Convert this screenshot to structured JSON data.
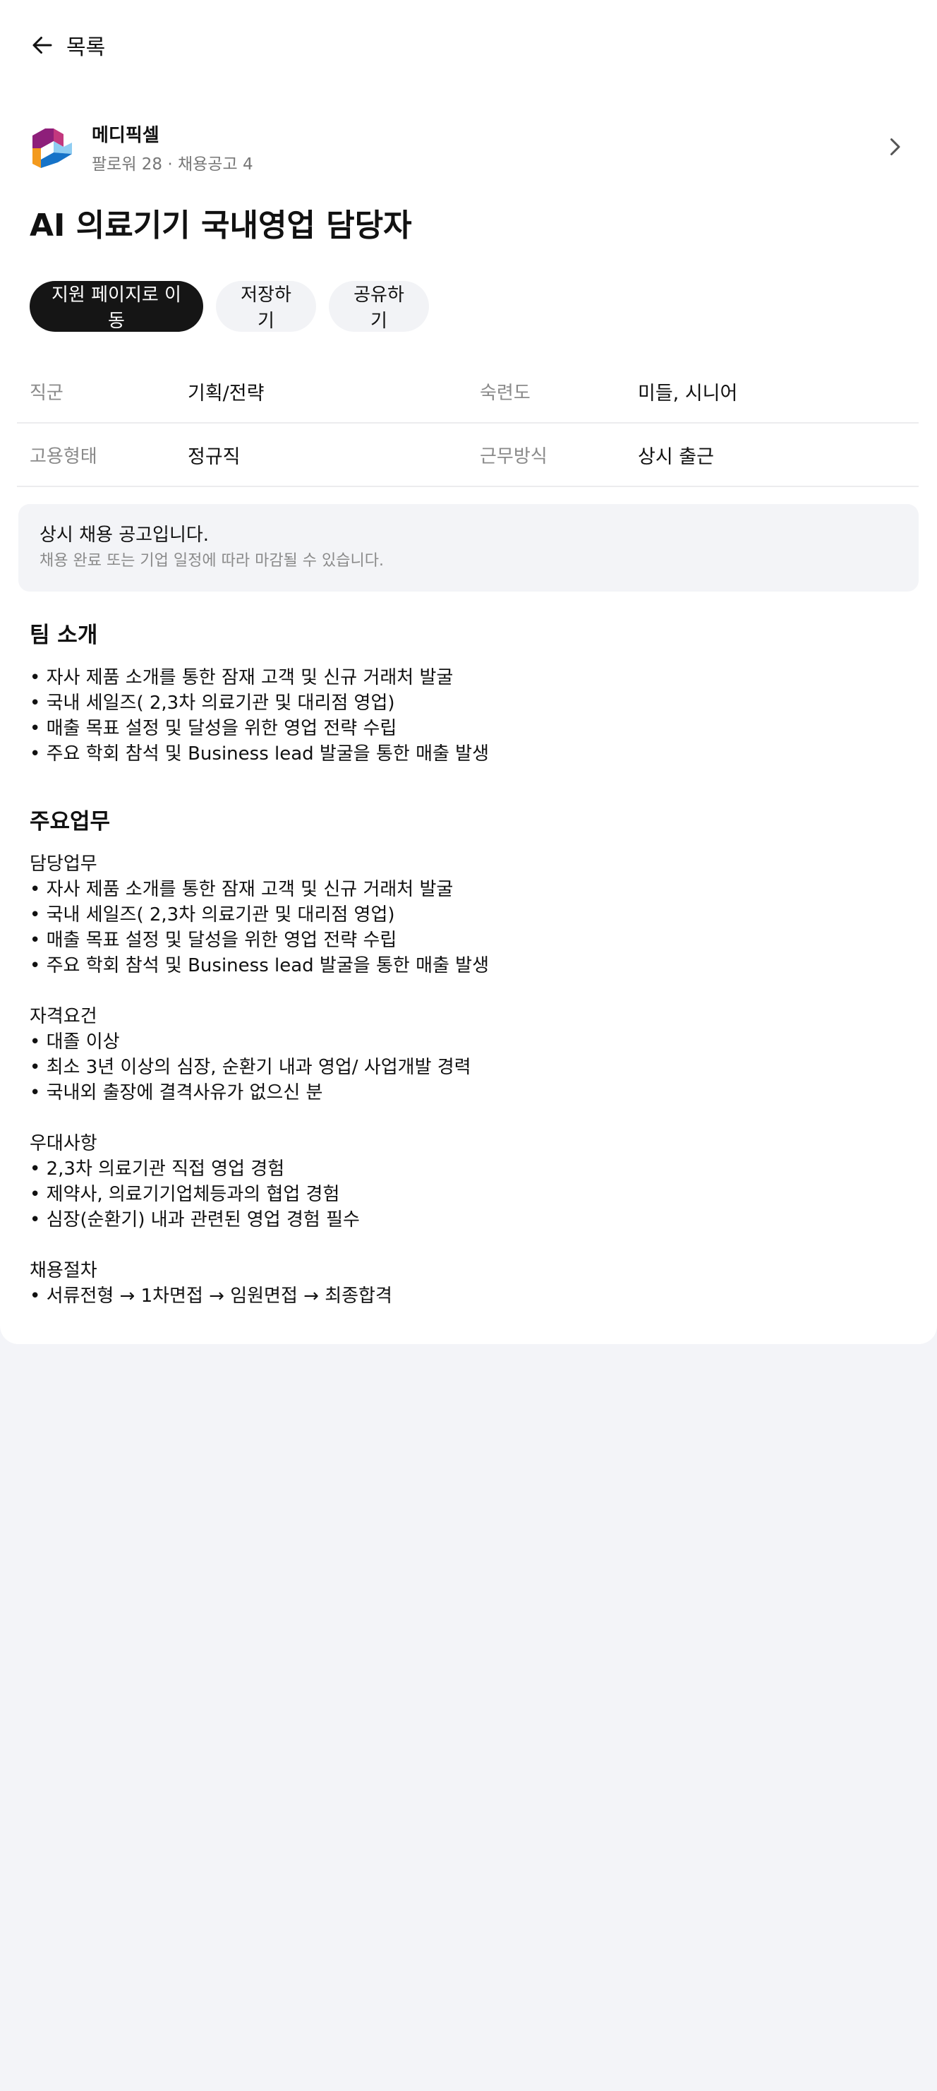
{
  "nav": {
    "back_label": "목록"
  },
  "company": {
    "name": "메디픽셀",
    "meta": "팔로워 28 · 채용공고 4"
  },
  "job": {
    "title": "AI 의료기기 국내영업 담당자"
  },
  "actions": {
    "apply_label": "지원 페이지로 이동",
    "save_label": "저장하기",
    "share_label": "공유하기"
  },
  "info": {
    "rows": [
      {
        "k1": "직군",
        "v1": "기획/전략",
        "k2": "숙련도",
        "v2": "미들, 시니어"
      },
      {
        "k1": "고용형태",
        "v1": "정규직",
        "k2": "근무방식",
        "v2": "상시 출근"
      }
    ]
  },
  "notice": {
    "title": "상시 채용 공고입니다.",
    "subtitle": "채용 완료 또는 기업 일정에 따라 마감될 수 있습니다."
  },
  "team": {
    "heading": "팀 소개",
    "lines": [
      "• 자사 제품 소개를 통한 잠재 고객 및 신규 거래처 발굴",
      "• 국내 세일즈( 2,3차 의료기관 및 대리점 영업)",
      "• 매출 목표 설정 및 달성을 위한 영업 전략 수립",
      "• 주요 학회 참석 및 Business lead 발굴을 통한 매출 발생"
    ]
  },
  "duties": {
    "heading": "주요업무",
    "lines": [
      "담당업무",
      "• 자사 제품 소개를 통한 잠재 고객 및 신규 거래처 발굴",
      "• 국내 세일즈( 2,3차 의료기관 및 대리점 영업)",
      "• 매출 목표 설정 및 달성을 위한 영업 전략 수립",
      "• 주요 학회 참석 및 Business lead 발굴을 통한 매출 발생",
      "",
      "자격요건",
      "• 대졸 이상",
      "• 최소 3년 이상의 심장, 순환기 내과 영업/ 사업개발 경력",
      "• 국내외 출장에 결격사유가 없으신 분",
      "",
      "우대사항",
      "• 2,3차 의료기관 직접 영업 경험",
      "• 제약사, 의료기기업체등과의 협업 경험",
      "• 심장(순환기) 내과 관련된 영업 경험 필수",
      "",
      "채용절차",
      "• 서류전형 → 1차면접 → 임원면접 → 최종합격"
    ]
  },
  "icons": {
    "back": "arrow-left-icon",
    "chevron": "chevron-right-icon",
    "logo": "company-logo"
  },
  "colors": {
    "primary_button": "#151515",
    "secondary_button": "#f2f3f6",
    "page_background": "#f3f4f8",
    "notice_background": "#f3f4f7",
    "logo_purple": "#8e1f7a",
    "logo_orange": "#f39a1e",
    "logo_blue": "#1673c8",
    "logo_light_blue": "#8fcdf2"
  }
}
